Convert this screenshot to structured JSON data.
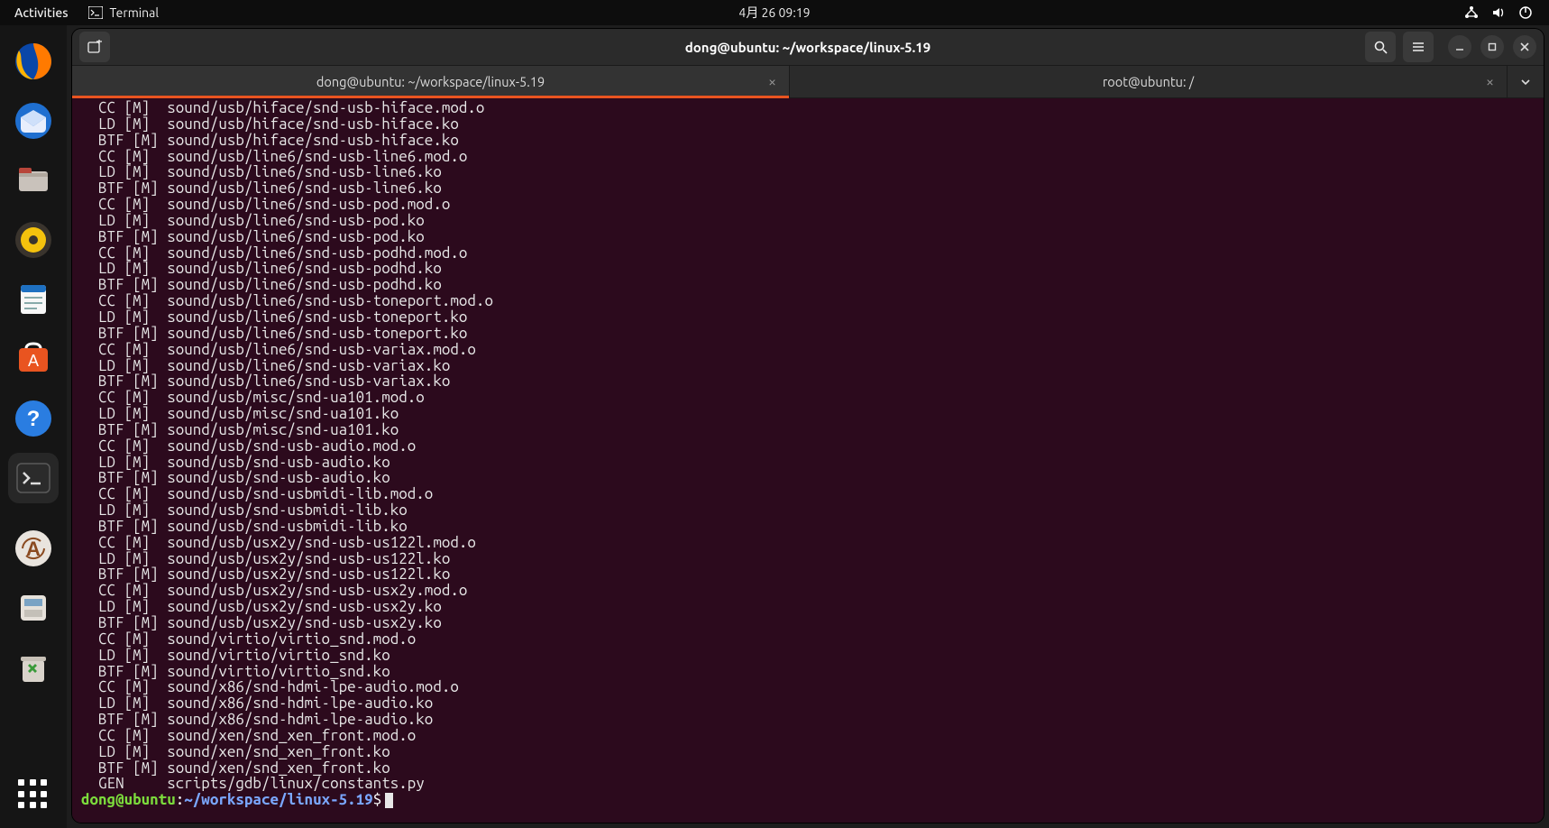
{
  "topbar": {
    "activities": "Activities",
    "app_name": "Terminal",
    "clock": "4月 26  09:19"
  },
  "dock": {
    "items": [
      {
        "name": "firefox-icon"
      },
      {
        "name": "thunderbird-icon"
      },
      {
        "name": "files-icon"
      },
      {
        "name": "rhythmbox-icon"
      },
      {
        "name": "writer-icon"
      },
      {
        "name": "software-icon"
      },
      {
        "name": "help-icon"
      },
      {
        "name": "terminal-icon"
      }
    ],
    "updater": {
      "name": "software-updater-icon"
    },
    "disks": {
      "name": "disks-icon"
    },
    "trash": {
      "name": "trash-icon"
    }
  },
  "window": {
    "title": "dong@ubuntu: ~/workspace/linux-5.19",
    "tabs": [
      {
        "label": "dong@ubuntu: ~/workspace/linux-5.19",
        "active": true
      },
      {
        "label": "root@ubuntu: /",
        "active": false
      }
    ]
  },
  "terminal": {
    "lines": [
      "  CC [M]  sound/usb/hiface/snd-usb-hiface.mod.o",
      "  LD [M]  sound/usb/hiface/snd-usb-hiface.ko",
      "  BTF [M] sound/usb/hiface/snd-usb-hiface.ko",
      "  CC [M]  sound/usb/line6/snd-usb-line6.mod.o",
      "  LD [M]  sound/usb/line6/snd-usb-line6.ko",
      "  BTF [M] sound/usb/line6/snd-usb-line6.ko",
      "  CC [M]  sound/usb/line6/snd-usb-pod.mod.o",
      "  LD [M]  sound/usb/line6/snd-usb-pod.ko",
      "  BTF [M] sound/usb/line6/snd-usb-pod.ko",
      "  CC [M]  sound/usb/line6/snd-usb-podhd.mod.o",
      "  LD [M]  sound/usb/line6/snd-usb-podhd.ko",
      "  BTF [M] sound/usb/line6/snd-usb-podhd.ko",
      "  CC [M]  sound/usb/line6/snd-usb-toneport.mod.o",
      "  LD [M]  sound/usb/line6/snd-usb-toneport.ko",
      "  BTF [M] sound/usb/line6/snd-usb-toneport.ko",
      "  CC [M]  sound/usb/line6/snd-usb-variax.mod.o",
      "  LD [M]  sound/usb/line6/snd-usb-variax.ko",
      "  BTF [M] sound/usb/line6/snd-usb-variax.ko",
      "  CC [M]  sound/usb/misc/snd-ua101.mod.o",
      "  LD [M]  sound/usb/misc/snd-ua101.ko",
      "  BTF [M] sound/usb/misc/snd-ua101.ko",
      "  CC [M]  sound/usb/snd-usb-audio.mod.o",
      "  LD [M]  sound/usb/snd-usb-audio.ko",
      "  BTF [M] sound/usb/snd-usb-audio.ko",
      "  CC [M]  sound/usb/snd-usbmidi-lib.mod.o",
      "  LD [M]  sound/usb/snd-usbmidi-lib.ko",
      "  BTF [M] sound/usb/snd-usbmidi-lib.ko",
      "  CC [M]  sound/usb/usx2y/snd-usb-us122l.mod.o",
      "  LD [M]  sound/usb/usx2y/snd-usb-us122l.ko",
      "  BTF [M] sound/usb/usx2y/snd-usb-us122l.ko",
      "  CC [M]  sound/usb/usx2y/snd-usb-usx2y.mod.o",
      "  LD [M]  sound/usb/usx2y/snd-usb-usx2y.ko",
      "  BTF [M] sound/usb/usx2y/snd-usb-usx2y.ko",
      "  CC [M]  sound/virtio/virtio_snd.mod.o",
      "  LD [M]  sound/virtio/virtio_snd.ko",
      "  BTF [M] sound/virtio/virtio_snd.ko",
      "  CC [M]  sound/x86/snd-hdmi-lpe-audio.mod.o",
      "  LD [M]  sound/x86/snd-hdmi-lpe-audio.ko",
      "  BTF [M] sound/x86/snd-hdmi-lpe-audio.ko",
      "  CC [M]  sound/xen/snd_xen_front.mod.o",
      "  LD [M]  sound/xen/snd_xen_front.ko",
      "  BTF [M] sound/xen/snd_xen_front.ko",
      "  GEN     scripts/gdb/linux/constants.py"
    ],
    "prompt": {
      "user": "dong",
      "host": "ubuntu",
      "path": "~/workspace/linux-5.19",
      "symbol": "$"
    }
  }
}
